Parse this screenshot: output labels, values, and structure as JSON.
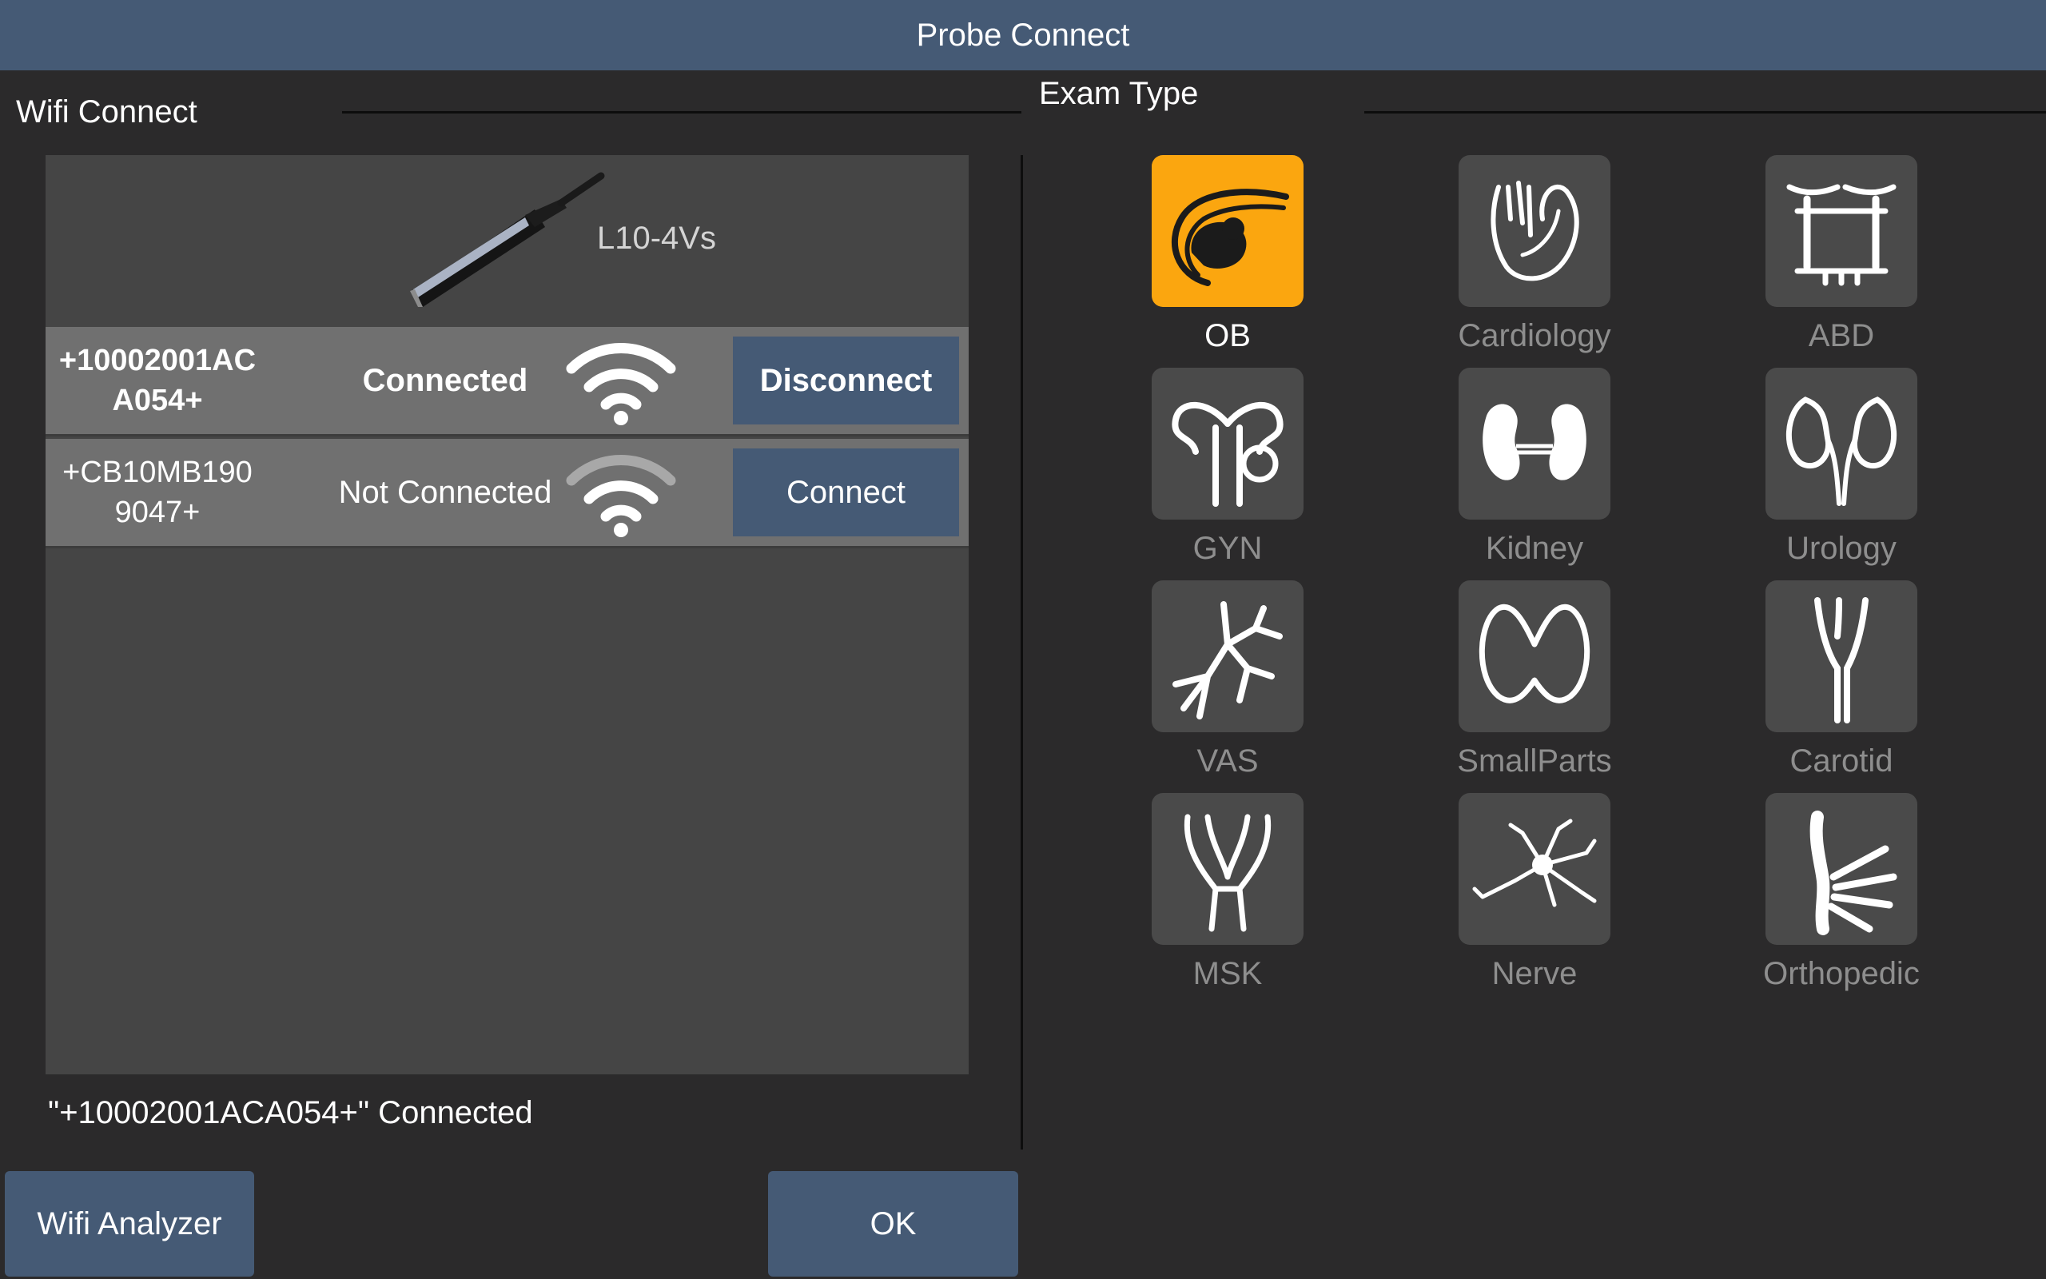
{
  "window": {
    "title": "Probe Connect"
  },
  "wifi_section": {
    "title": "Wifi Connect"
  },
  "exam_section": {
    "title": "Exam Type"
  },
  "probe": {
    "model": "L10-4Vs"
  },
  "devices": [
    {
      "id": "+10002001AC\nA054+",
      "status": "Connected",
      "action": "Disconnect",
      "signal_color": "#ffffff"
    },
    {
      "id": "+CB10MB190\n9047+",
      "status": "Not Connected",
      "action": "Connect",
      "signal_color": "#a8a8a8"
    }
  ],
  "status_message": "\"+10002001ACA054+\" Connected",
  "buttons": {
    "wifi_analyzer": "Wifi Analyzer",
    "ok": "OK"
  },
  "exam_types": [
    {
      "label": "OB",
      "icon": "fetus-icon",
      "selected": true
    },
    {
      "label": "Cardiology",
      "icon": "heart-icon",
      "selected": false
    },
    {
      "label": "ABD",
      "icon": "abdomen-icon",
      "selected": false
    },
    {
      "label": "GYN",
      "icon": "uterus-icon",
      "selected": false
    },
    {
      "label": "Kidney",
      "icon": "kidney-icon",
      "selected": false
    },
    {
      "label": "Urology",
      "icon": "urinary-tract-icon",
      "selected": false
    },
    {
      "label": "VAS",
      "icon": "vessels-icon",
      "selected": false
    },
    {
      "label": "SmallParts",
      "icon": "thyroid-icon",
      "selected": false
    },
    {
      "label": "Carotid",
      "icon": "carotid-icon",
      "selected": false
    },
    {
      "label": "MSK",
      "icon": "muscle-icon",
      "selected": false
    },
    {
      "label": "Nerve",
      "icon": "neuron-icon",
      "selected": false
    },
    {
      "label": "Orthopedic",
      "icon": "bone-icon",
      "selected": false
    }
  ],
  "colors": {
    "accent": "#455a75",
    "selected": "#fba60f"
  }
}
